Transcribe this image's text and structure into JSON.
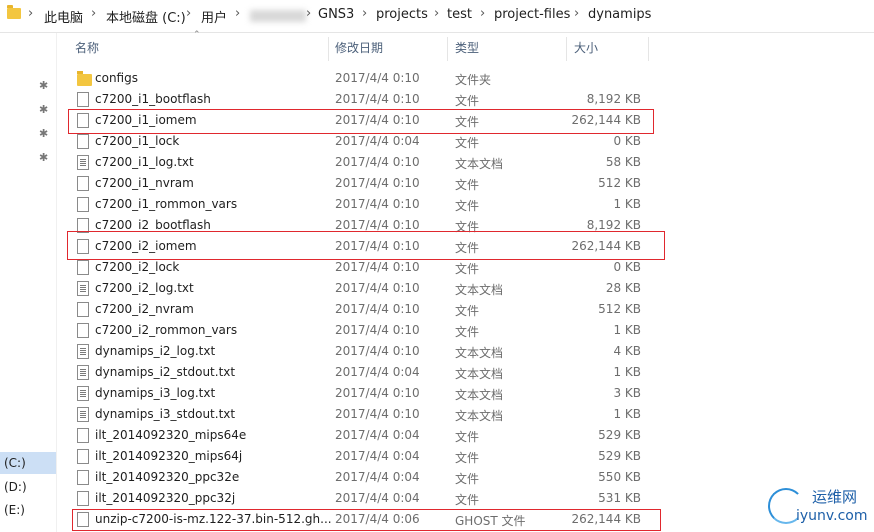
{
  "breadcrumb": [
    "此电脑",
    "本地磁盘 (C:)",
    "用户",
    "GNS3",
    "projects",
    "test",
    "project-files",
    "dynamips"
  ],
  "columns": {
    "name": "名称",
    "date": "修改日期",
    "type": "类型",
    "size": "大小"
  },
  "nav": {
    "drives": [
      "(C:)",
      "(D:)",
      "(E:)"
    ]
  },
  "files": [
    {
      "name": "configs",
      "date": "2017/4/4 0:10",
      "type": "文件夹",
      "size": "",
      "icon": "folder"
    },
    {
      "name": "c7200_i1_bootflash",
      "date": "2017/4/4 0:10",
      "type": "文件",
      "size": "8,192 KB",
      "icon": "file"
    },
    {
      "name": "c7200_i1_iomem",
      "date": "2017/4/4 0:10",
      "type": "文件",
      "size": "262,144 KB",
      "icon": "file"
    },
    {
      "name": "c7200_i1_lock",
      "date": "2017/4/4 0:04",
      "type": "文件",
      "size": "0 KB",
      "icon": "file"
    },
    {
      "name": "c7200_i1_log.txt",
      "date": "2017/4/4 0:10",
      "type": "文本文档",
      "size": "58 KB",
      "icon": "text"
    },
    {
      "name": "c7200_i1_nvram",
      "date": "2017/4/4 0:10",
      "type": "文件",
      "size": "512 KB",
      "icon": "file"
    },
    {
      "name": "c7200_i1_rommon_vars",
      "date": "2017/4/4 0:10",
      "type": "文件",
      "size": "1 KB",
      "icon": "file"
    },
    {
      "name": "c7200_i2_bootflash",
      "date": "2017/4/4 0:10",
      "type": "文件",
      "size": "8,192 KB",
      "icon": "file"
    },
    {
      "name": "c7200_i2_iomem",
      "date": "2017/4/4 0:10",
      "type": "文件",
      "size": "262,144 KB",
      "icon": "file"
    },
    {
      "name": "c7200_i2_lock",
      "date": "2017/4/4 0:10",
      "type": "文件",
      "size": "0 KB",
      "icon": "file"
    },
    {
      "name": "c7200_i2_log.txt",
      "date": "2017/4/4 0:10",
      "type": "文本文档",
      "size": "28 KB",
      "icon": "text"
    },
    {
      "name": "c7200_i2_nvram",
      "date": "2017/4/4 0:10",
      "type": "文件",
      "size": "512 KB",
      "icon": "file"
    },
    {
      "name": "c7200_i2_rommon_vars",
      "date": "2017/4/4 0:10",
      "type": "文件",
      "size": "1 KB",
      "icon": "file"
    },
    {
      "name": "dynamips_i2_log.txt",
      "date": "2017/4/4 0:10",
      "type": "文本文档",
      "size": "4 KB",
      "icon": "text"
    },
    {
      "name": "dynamips_i2_stdout.txt",
      "date": "2017/4/4 0:04",
      "type": "文本文档",
      "size": "1 KB",
      "icon": "text"
    },
    {
      "name": "dynamips_i3_log.txt",
      "date": "2017/4/4 0:10",
      "type": "文本文档",
      "size": "3 KB",
      "icon": "text"
    },
    {
      "name": "dynamips_i3_stdout.txt",
      "date": "2017/4/4 0:10",
      "type": "文本文档",
      "size": "1 KB",
      "icon": "text"
    },
    {
      "name": "ilt_2014092320_mips64e",
      "date": "2017/4/4 0:04",
      "type": "文件",
      "size": "529 KB",
      "icon": "file"
    },
    {
      "name": "ilt_2014092320_mips64j",
      "date": "2017/4/4 0:04",
      "type": "文件",
      "size": "529 KB",
      "icon": "file"
    },
    {
      "name": "ilt_2014092320_ppc32e",
      "date": "2017/4/4 0:04",
      "type": "文件",
      "size": "550 KB",
      "icon": "file"
    },
    {
      "name": "ilt_2014092320_ppc32j",
      "date": "2017/4/4 0:04",
      "type": "文件",
      "size": "531 KB",
      "icon": "file"
    },
    {
      "name": "unzip-c7200-is-mz.122-37.bin-512.gh...",
      "date": "2017/4/4 0:06",
      "type": "GHOST 文件",
      "size": "262,144 KB",
      "icon": "file"
    }
  ],
  "highlighted_rows": [
    2,
    8,
    21
  ],
  "highlight_color": "#e0282e",
  "watermark": {
    "cn": "运维网",
    "url": "iyunv.com"
  }
}
